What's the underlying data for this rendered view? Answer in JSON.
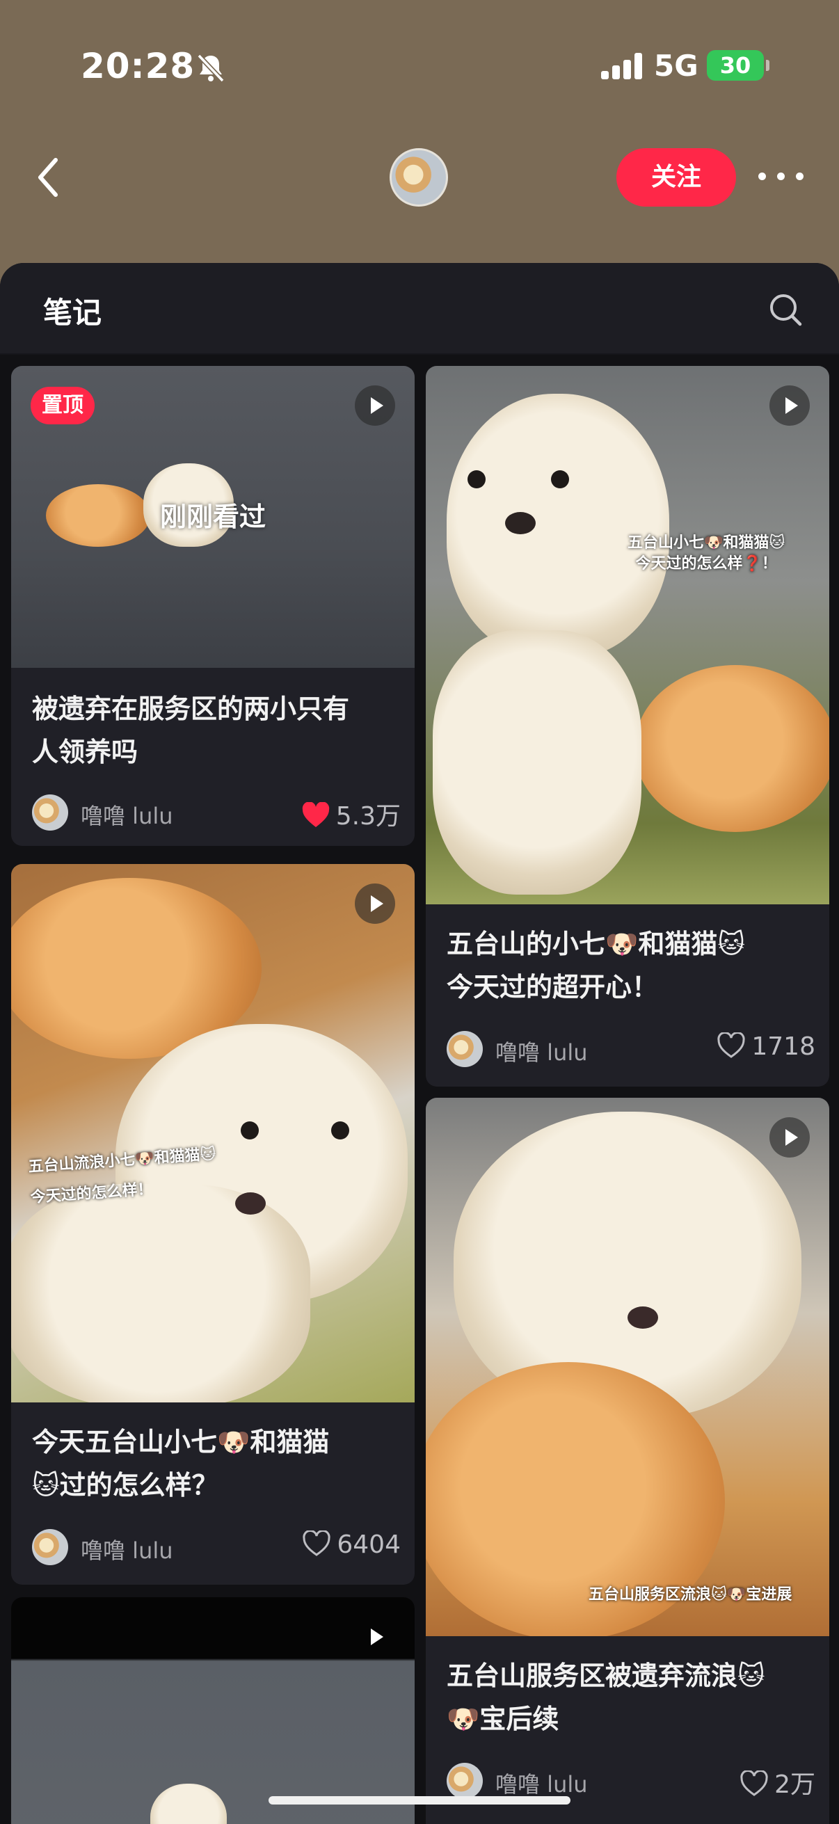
{
  "status_bar": {
    "time": "20:28",
    "network": "5G",
    "battery": "30"
  },
  "header": {
    "follow_label": "关注"
  },
  "section": {
    "title": "笔记"
  },
  "cards": [
    {
      "badge": "置顶",
      "overlay": "刚刚看过",
      "title_line1": "被遗弃在服务区的两小只有",
      "title_line2": "人领养吗",
      "author": "噜噜 lulu",
      "likes": "5.3万",
      "liked": true
    },
    {
      "overlay_line1": "五台山小七🐶和猫猫🐱",
      "overlay_line2": "今天过的怎么样❓！",
      "title_line1": "五台山的小七🐶和猫猫🐱",
      "title_line2": "今天过的超开心！",
      "author": "噜噜 lulu",
      "likes": "1718",
      "liked": false
    },
    {
      "overlay_line1": "五台山流浪小七🐶和猫猫🐱",
      "overlay_line2": "今天过的怎么样！",
      "title_line1": "今天五台山小七🐶和猫猫",
      "title_line2": "🐱过的怎么样？",
      "author": "噜噜 lulu",
      "likes": "6404",
      "liked": false
    },
    {
      "overlay_line1": "五台山服务区流浪🐱🐶宝进展",
      "title_line1": "五台山服务区被遗弃流浪🐱",
      "title_line2": "🐶宝后续",
      "author": "噜噜 lulu",
      "likes": "2万",
      "liked": false
    },
    {
      "title_line1": "",
      "author": "",
      "likes": ""
    }
  ],
  "icons": [
    "back-icon",
    "bell-slash-icon",
    "signal-icon",
    "more-icon",
    "search-icon",
    "play-icon",
    "heart-icon"
  ],
  "colors": {
    "accent": "#ff2748",
    "sheet": "#1c1c22",
    "card": "#202027"
  }
}
